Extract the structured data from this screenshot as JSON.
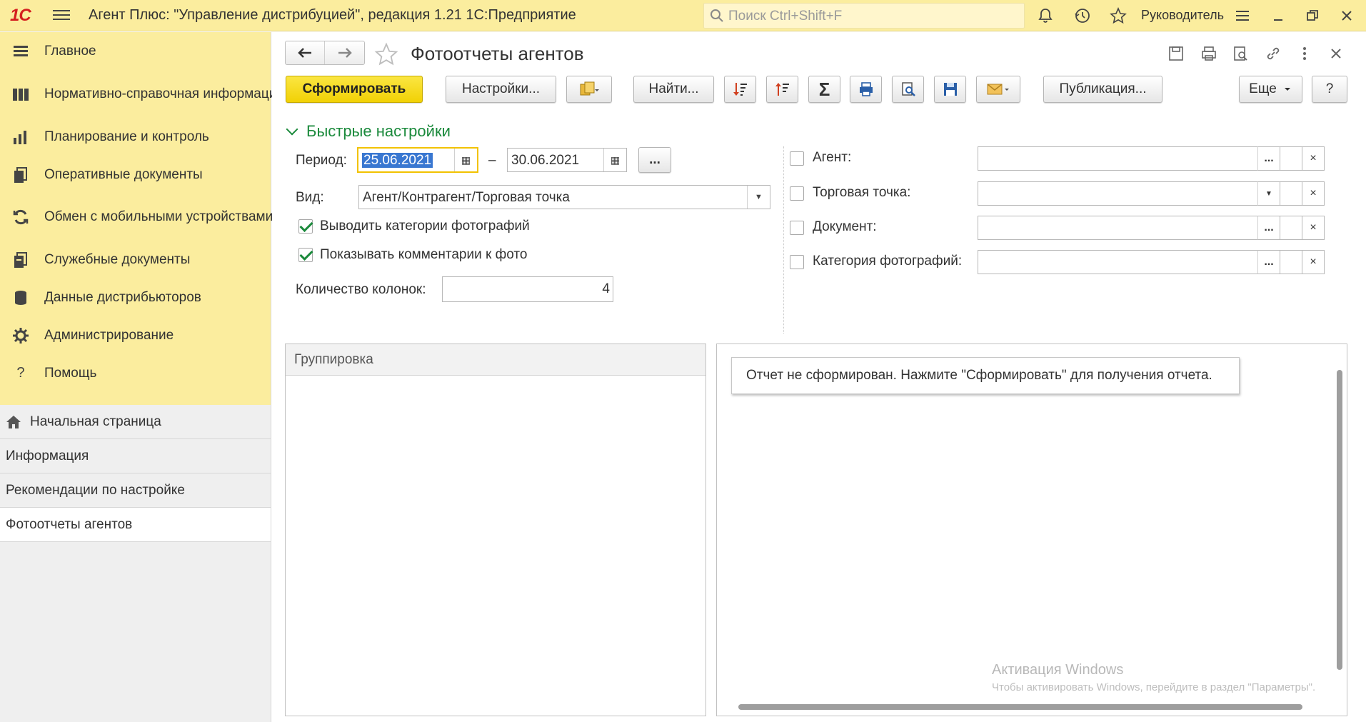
{
  "titlebar": {
    "app_title": "Агент Плюс: \"Управление дистрибуцией\", редакция 1.21 1С:Предприятие",
    "search_placeholder": "Поиск Ctrl+Shift+F",
    "user": "Руководитель",
    "logo": "1С"
  },
  "sidebar": {
    "sections": [
      {
        "label": "Главное",
        "icon": "menu-list-icon"
      },
      {
        "label": "Нормативно-справочная информация",
        "icon": "catalog-icon"
      },
      {
        "label": "Планирование и контроль",
        "icon": "chart-icon"
      },
      {
        "label": "Оперативные документы",
        "icon": "documents-icon"
      },
      {
        "label": "Обмен с мобильными устройствами",
        "icon": "sync-icon"
      },
      {
        "label": "Служебные документы",
        "icon": "service-docs-icon"
      },
      {
        "label": "Данные дистрибьюторов",
        "icon": "database-icon"
      },
      {
        "label": "Администрирование",
        "icon": "gear-icon"
      },
      {
        "label": "Помощь",
        "icon": "question-icon"
      }
    ],
    "open_windows": [
      {
        "label": "Начальная страница"
      },
      {
        "label": "Информация"
      },
      {
        "label": "Рекомендации по настройке"
      },
      {
        "label": "Фотоотчеты агентов"
      }
    ]
  },
  "form": {
    "title": "Фотоотчеты агентов",
    "toolbar": {
      "generate": "Сформировать",
      "settings": "Настройки...",
      "find": "Найти...",
      "publish": "Публикация...",
      "more": "Еще",
      "help": "?"
    },
    "quick_settings": {
      "header": "Быстрые настройки",
      "period_label": "Период:",
      "date_from": "25.06.2021",
      "date_dash": "–",
      "date_to": "30.06.2021",
      "period_more": "...",
      "view_label": "Вид:",
      "view_value": "Агент/Контрагент/Торговая точка",
      "show_photo_categories": "Выводить категории фотографий",
      "show_photo_comments": "Показывать комментарии к фото",
      "columns_label": "Количество колонок:",
      "columns_value": "4",
      "agent_label": "Агент:",
      "outlet_label": "Торговая точка:",
      "document_label": "Документ:",
      "photo_category_label": "Категория фотографий:"
    },
    "grouping_header": "Группировка",
    "report_message": "Отчет не сформирован. Нажмите \"Сформировать\" для получения отчета.",
    "watermark": {
      "title": "Активация Windows",
      "subtitle": "Чтобы активировать Windows, перейдите в раздел \"Параметры\"."
    }
  }
}
